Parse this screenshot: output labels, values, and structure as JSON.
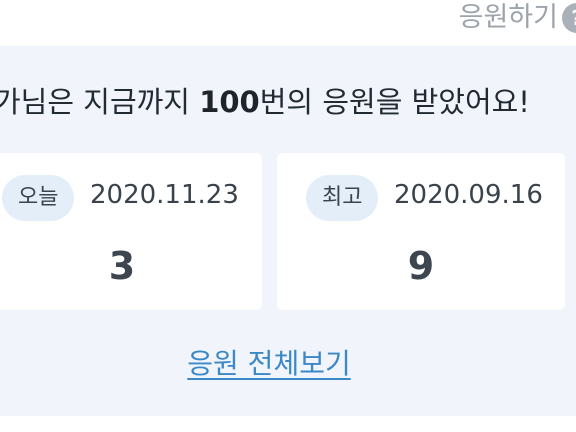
{
  "header": {
    "cheer_label": "응원하기",
    "help_icon_glyph": "?"
  },
  "summary": {
    "text_before": "가님은 지금까지 ",
    "count_bold": "100",
    "text_after": "번의 응원을 받았어요!"
  },
  "cards": {
    "today": {
      "label": "오늘",
      "date": "2020.11.23",
      "count": "3"
    },
    "best": {
      "label": "최고",
      "date": "2020.09.16",
      "count": "9"
    }
  },
  "footer": {
    "view_all_label": "응원 전체보기"
  },
  "colors": {
    "panel_bg": "#f1f5fb",
    "pill_bg": "#e4eef9",
    "link": "#3b88c7",
    "muted": "#9ca3aa"
  }
}
